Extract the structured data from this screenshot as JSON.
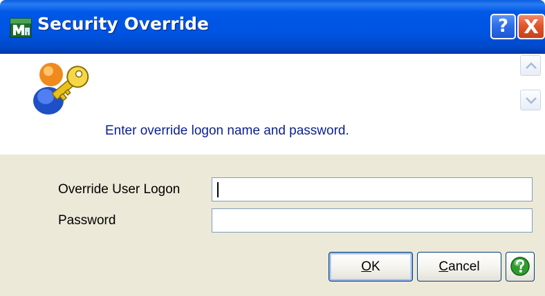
{
  "window": {
    "title": "Security Override",
    "app_icon": "app-m-icon",
    "help_glyph": "?",
    "close_glyph": "X"
  },
  "header": {
    "icon": "user-key-icon",
    "instruction": "Enter override logon name and password."
  },
  "form": {
    "user_label": "Override User Logon",
    "user_value": "",
    "password_label": "Password",
    "password_value": ""
  },
  "buttons": {
    "ok_mnemonic": "O",
    "ok_rest": "K",
    "cancel_mnemonic": "C",
    "cancel_rest": "ancel",
    "help_icon": "help-circle-icon"
  },
  "colors": {
    "titlebar": "#0054e3",
    "panel": "#ece9d8",
    "instruction_text": "#0a1f8f",
    "help_green": "#2e9b2e"
  }
}
